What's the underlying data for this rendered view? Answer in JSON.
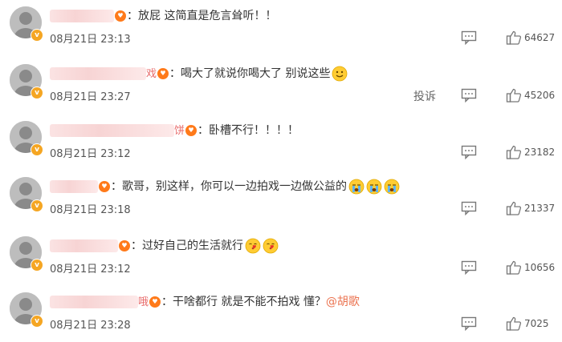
{
  "comments": [
    {
      "name_tail": "",
      "text": "：放屁 这简直是危言耸听！！",
      "mention": "",
      "time": "08月21日 23:13",
      "likes": "64627",
      "emoji_names": [],
      "report": "",
      "name_blur_width": 80
    },
    {
      "name_tail": "戏",
      "text": "：喝大了就说你喝大了 别说这些",
      "mention": "",
      "time": "08月21日 23:27",
      "likes": "45206",
      "emoji_names": [
        "smile-emoji"
      ],
      "report": "投诉",
      "name_blur_width": 120
    },
    {
      "name_tail": "饼",
      "text": "：卧槽不行！！！！",
      "mention": "",
      "time": "08月21日 23:12",
      "likes": "23182",
      "emoji_names": [],
      "report": "",
      "name_blur_width": 155
    },
    {
      "name_tail": "",
      "text": "：歌哥，别这样，你可以一边拍戏一边做公益的",
      "mention": "",
      "time": "08月21日 23:18",
      "likes": "21337",
      "emoji_names": [
        "crying-emoji",
        "crying-emoji",
        "crying-emoji"
      ],
      "report": "",
      "name_blur_width": 60
    },
    {
      "name_tail": "",
      "text": "：过好自己的生活就行",
      "mention": "",
      "time": "08月21日 23:12",
      "likes": "10656",
      "emoji_names": [
        "kiss-emoji",
        "kiss-emoji"
      ],
      "report": "",
      "name_blur_width": 85
    },
    {
      "name_tail": "哦",
      "text": "：干啥都行 就是不能不拍戏 懂？",
      "mention": "@胡歌",
      "time": "08月21日 23:28",
      "likes": "7025",
      "emoji_names": [],
      "report": "",
      "name_blur_width": 110
    }
  ]
}
